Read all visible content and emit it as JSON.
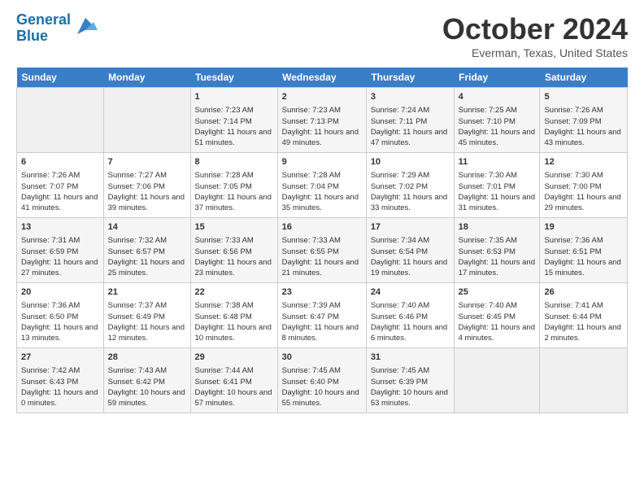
{
  "header": {
    "logo_line1": "General",
    "logo_line2": "Blue",
    "month_title": "October 2024",
    "location": "Everman, Texas, United States"
  },
  "days_of_week": [
    "Sunday",
    "Monday",
    "Tuesday",
    "Wednesday",
    "Thursday",
    "Friday",
    "Saturday"
  ],
  "weeks": [
    [
      {
        "day": "",
        "sunrise": "",
        "sunset": "",
        "daylight": ""
      },
      {
        "day": "",
        "sunrise": "",
        "sunset": "",
        "daylight": ""
      },
      {
        "day": "1",
        "sunrise": "Sunrise: 7:23 AM",
        "sunset": "Sunset: 7:14 PM",
        "daylight": "Daylight: 11 hours and 51 minutes."
      },
      {
        "day": "2",
        "sunrise": "Sunrise: 7:23 AM",
        "sunset": "Sunset: 7:13 PM",
        "daylight": "Daylight: 11 hours and 49 minutes."
      },
      {
        "day": "3",
        "sunrise": "Sunrise: 7:24 AM",
        "sunset": "Sunset: 7:11 PM",
        "daylight": "Daylight: 11 hours and 47 minutes."
      },
      {
        "day": "4",
        "sunrise": "Sunrise: 7:25 AM",
        "sunset": "Sunset: 7:10 PM",
        "daylight": "Daylight: 11 hours and 45 minutes."
      },
      {
        "day": "5",
        "sunrise": "Sunrise: 7:26 AM",
        "sunset": "Sunset: 7:09 PM",
        "daylight": "Daylight: 11 hours and 43 minutes."
      }
    ],
    [
      {
        "day": "6",
        "sunrise": "Sunrise: 7:26 AM",
        "sunset": "Sunset: 7:07 PM",
        "daylight": "Daylight: 11 hours and 41 minutes."
      },
      {
        "day": "7",
        "sunrise": "Sunrise: 7:27 AM",
        "sunset": "Sunset: 7:06 PM",
        "daylight": "Daylight: 11 hours and 39 minutes."
      },
      {
        "day": "8",
        "sunrise": "Sunrise: 7:28 AM",
        "sunset": "Sunset: 7:05 PM",
        "daylight": "Daylight: 11 hours and 37 minutes."
      },
      {
        "day": "9",
        "sunrise": "Sunrise: 7:28 AM",
        "sunset": "Sunset: 7:04 PM",
        "daylight": "Daylight: 11 hours and 35 minutes."
      },
      {
        "day": "10",
        "sunrise": "Sunrise: 7:29 AM",
        "sunset": "Sunset: 7:02 PM",
        "daylight": "Daylight: 11 hours and 33 minutes."
      },
      {
        "day": "11",
        "sunrise": "Sunrise: 7:30 AM",
        "sunset": "Sunset: 7:01 PM",
        "daylight": "Daylight: 11 hours and 31 minutes."
      },
      {
        "day": "12",
        "sunrise": "Sunrise: 7:30 AM",
        "sunset": "Sunset: 7:00 PM",
        "daylight": "Daylight: 11 hours and 29 minutes."
      }
    ],
    [
      {
        "day": "13",
        "sunrise": "Sunrise: 7:31 AM",
        "sunset": "Sunset: 6:59 PM",
        "daylight": "Daylight: 11 hours and 27 minutes."
      },
      {
        "day": "14",
        "sunrise": "Sunrise: 7:32 AM",
        "sunset": "Sunset: 6:57 PM",
        "daylight": "Daylight: 11 hours and 25 minutes."
      },
      {
        "day": "15",
        "sunrise": "Sunrise: 7:33 AM",
        "sunset": "Sunset: 6:56 PM",
        "daylight": "Daylight: 11 hours and 23 minutes."
      },
      {
        "day": "16",
        "sunrise": "Sunrise: 7:33 AM",
        "sunset": "Sunset: 6:55 PM",
        "daylight": "Daylight: 11 hours and 21 minutes."
      },
      {
        "day": "17",
        "sunrise": "Sunrise: 7:34 AM",
        "sunset": "Sunset: 6:54 PM",
        "daylight": "Daylight: 11 hours and 19 minutes."
      },
      {
        "day": "18",
        "sunrise": "Sunrise: 7:35 AM",
        "sunset": "Sunset: 6:53 PM",
        "daylight": "Daylight: 11 hours and 17 minutes."
      },
      {
        "day": "19",
        "sunrise": "Sunrise: 7:36 AM",
        "sunset": "Sunset: 6:51 PM",
        "daylight": "Daylight: 11 hours and 15 minutes."
      }
    ],
    [
      {
        "day": "20",
        "sunrise": "Sunrise: 7:36 AM",
        "sunset": "Sunset: 6:50 PM",
        "daylight": "Daylight: 11 hours and 13 minutes."
      },
      {
        "day": "21",
        "sunrise": "Sunrise: 7:37 AM",
        "sunset": "Sunset: 6:49 PM",
        "daylight": "Daylight: 11 hours and 12 minutes."
      },
      {
        "day": "22",
        "sunrise": "Sunrise: 7:38 AM",
        "sunset": "Sunset: 6:48 PM",
        "daylight": "Daylight: 11 hours and 10 minutes."
      },
      {
        "day": "23",
        "sunrise": "Sunrise: 7:39 AM",
        "sunset": "Sunset: 6:47 PM",
        "daylight": "Daylight: 11 hours and 8 minutes."
      },
      {
        "day": "24",
        "sunrise": "Sunrise: 7:40 AM",
        "sunset": "Sunset: 6:46 PM",
        "daylight": "Daylight: 11 hours and 6 minutes."
      },
      {
        "day": "25",
        "sunrise": "Sunrise: 7:40 AM",
        "sunset": "Sunset: 6:45 PM",
        "daylight": "Daylight: 11 hours and 4 minutes."
      },
      {
        "day": "26",
        "sunrise": "Sunrise: 7:41 AM",
        "sunset": "Sunset: 6:44 PM",
        "daylight": "Daylight: 11 hours and 2 minutes."
      }
    ],
    [
      {
        "day": "27",
        "sunrise": "Sunrise: 7:42 AM",
        "sunset": "Sunset: 6:43 PM",
        "daylight": "Daylight: 11 hours and 0 minutes."
      },
      {
        "day": "28",
        "sunrise": "Sunrise: 7:43 AM",
        "sunset": "Sunset: 6:42 PM",
        "daylight": "Daylight: 10 hours and 59 minutes."
      },
      {
        "day": "29",
        "sunrise": "Sunrise: 7:44 AM",
        "sunset": "Sunset: 6:41 PM",
        "daylight": "Daylight: 10 hours and 57 minutes."
      },
      {
        "day": "30",
        "sunrise": "Sunrise: 7:45 AM",
        "sunset": "Sunset: 6:40 PM",
        "daylight": "Daylight: 10 hours and 55 minutes."
      },
      {
        "day": "31",
        "sunrise": "Sunrise: 7:45 AM",
        "sunset": "Sunset: 6:39 PM",
        "daylight": "Daylight: 10 hours and 53 minutes."
      },
      {
        "day": "",
        "sunrise": "",
        "sunset": "",
        "daylight": ""
      },
      {
        "day": "",
        "sunrise": "",
        "sunset": "",
        "daylight": ""
      }
    ]
  ]
}
